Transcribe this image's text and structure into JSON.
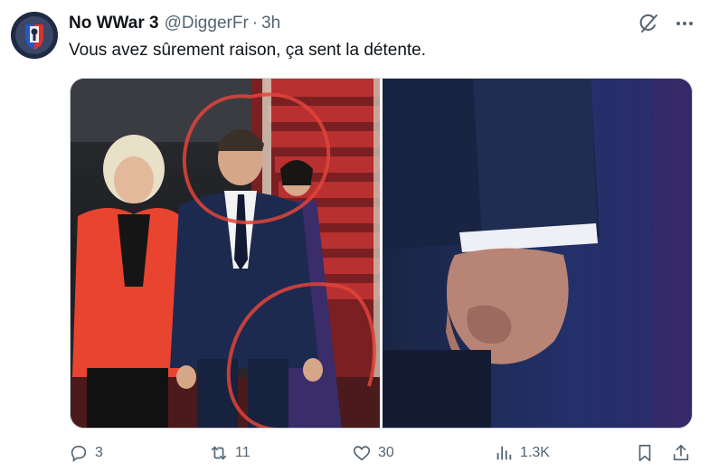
{
  "tweet": {
    "display_name": "No WWar 3",
    "handle": "@DiggerFr",
    "separator": "·",
    "time": "3h",
    "text": "Vous avez sûrement raison, ça sent la détente."
  },
  "actions": {
    "replies": "3",
    "retweets": "11",
    "likes": "30",
    "views": "1.3K"
  },
  "media": {
    "left_photo": "couple-walking-on-red-carpet-with-red-circle-annotations",
    "right_photo": "close-up-of-clenched-fist-with-white-shirt-cuff"
  },
  "colors": {
    "text": "#0f1419",
    "secondary": "#536471",
    "annotation": "#e0443a",
    "jacket": "#e8442f",
    "suit": "#1c2a4f"
  },
  "icons": {
    "grok": "grok-icon",
    "more": "more-icon",
    "reply": "reply-icon",
    "retweet": "retweet-icon",
    "like": "heart-icon",
    "views": "views-icon",
    "bookmark": "bookmark-icon",
    "share": "share-icon"
  }
}
